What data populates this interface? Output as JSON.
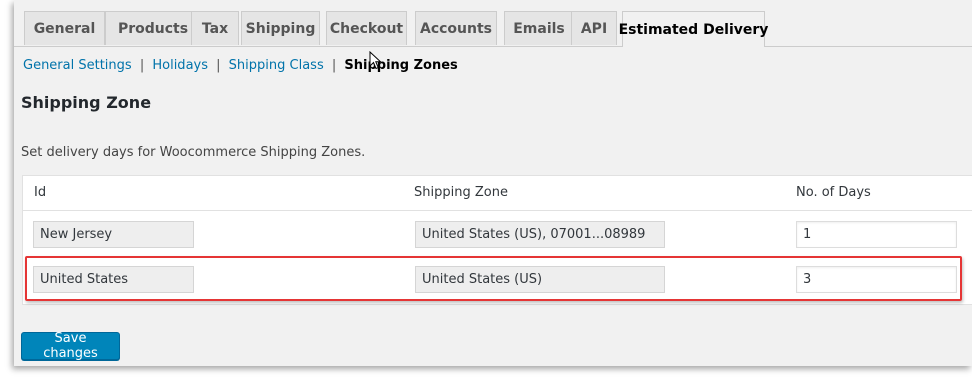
{
  "tabs": [
    {
      "label": "General"
    },
    {
      "label": "Products"
    },
    {
      "label": "Tax"
    },
    {
      "label": "Shipping"
    },
    {
      "label": "Checkout"
    },
    {
      "label": "Accounts"
    },
    {
      "label": "Emails"
    },
    {
      "label": "API"
    },
    {
      "label": "Estimated Delivery",
      "active": true
    }
  ],
  "subnav": {
    "items": [
      "General Settings",
      "Holidays",
      "Shipping Class"
    ],
    "separator": "|",
    "current": "Shipping Zones"
  },
  "section": {
    "title": "Shipping Zone",
    "description": "Set delivery days for Woocommerce Shipping Zones."
  },
  "table": {
    "headers": [
      "Id",
      "Shipping Zone",
      "No. of Days"
    ],
    "rows": [
      {
        "id": "New Jersey",
        "zone": "United States (US), 07001...08989",
        "days": "1"
      },
      {
        "id": "United States",
        "zone": "United States (US)",
        "days": "3"
      }
    ]
  },
  "save_label": "Save changes",
  "colors": {
    "accent": "#0085ba",
    "link": "#0073aa",
    "highlight": "#e53535"
  }
}
